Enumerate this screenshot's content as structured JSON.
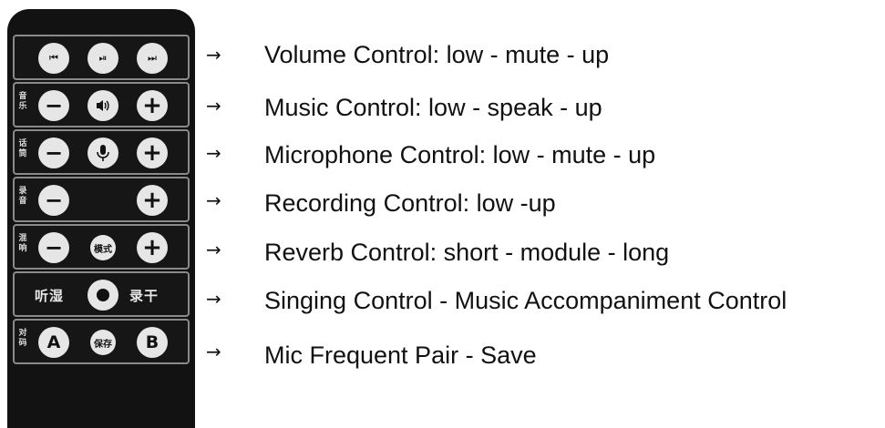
{
  "rows": [
    {
      "arrow": "→",
      "label": "Volume Control:  low - mute - up"
    },
    {
      "arrow": "→",
      "label": "Music Control: low - speak - up"
    },
    {
      "arrow": "→",
      "label": "Microphone Control: low - mute - up"
    },
    {
      "arrow": "→",
      "label": "Recording Control: low -up"
    },
    {
      "arrow": "→",
      "label": "Reverb Control: short - module - long"
    },
    {
      "arrow": "→",
      "label": "Singing Control - Music Accompaniment Control"
    },
    {
      "arrow": "→",
      "label": "Mic Frequent Pair - Save"
    }
  ],
  "remote": {
    "tags": {
      "music": "音乐",
      "mic": "话筒",
      "record": "录音",
      "reverb": "混响",
      "pair": "对码"
    },
    "mode_button": "模式",
    "save_button": "保存",
    "singing_left": "听湿",
    "singing_right": "录干",
    "pair_a": "A",
    "pair_b": "B",
    "minus": "−",
    "plus": "+"
  }
}
